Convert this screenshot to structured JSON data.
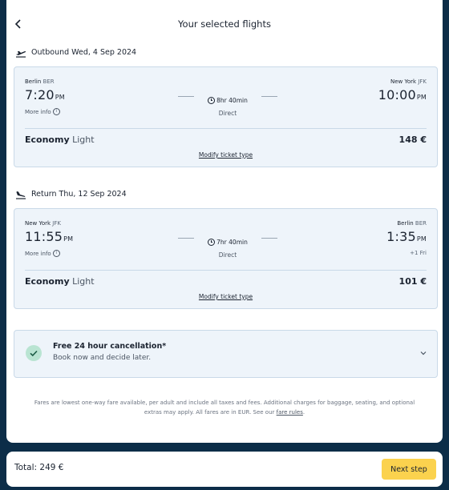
{
  "header": {
    "title": "Your selected flights"
  },
  "outbound": {
    "label": "Outbound Wed, 4 Sep 2024",
    "origin_city": "Berlin",
    "origin_code": "BER",
    "dest_city": "New York",
    "dest_code": "JFK",
    "dep_time": "7:20",
    "dep_ampm": "PM",
    "arr_time": "10:00",
    "arr_ampm": "PM",
    "duration": "8hr 40min",
    "stops": "Direct",
    "more_info": "More info",
    "fare_class": "Economy",
    "fare_type": "Light",
    "price": "148 €",
    "modify_label": "Modify ticket type"
  },
  "return": {
    "label": "Return Thu, 12 Sep 2024",
    "origin_city": "New York",
    "origin_code": "JFK",
    "dest_city": "Berlin",
    "dest_code": "BER",
    "dep_time": "11:55",
    "dep_ampm": "PM",
    "arr_time": "1:35",
    "arr_ampm": "PM",
    "day_offset": "+1 Fri",
    "duration": "7hr 40min",
    "stops": "Direct",
    "more_info": "More info",
    "fare_class": "Economy",
    "fare_type": "Light",
    "price": "101 €",
    "modify_label": "Modify ticket type"
  },
  "cancellation": {
    "title": "Free 24 hour cancellation*",
    "subtitle": "Book now and decide later."
  },
  "disclaimer": {
    "text": "Fares are lowest one-way fare available, per adult and include all taxes and fees. Additional charges for baggage, seating, and optional extras may apply. All fares are in EUR. See our",
    "link": "fare rules",
    "end": "."
  },
  "footer": {
    "total": "Total: 249 €",
    "next_label": "Next step"
  },
  "colors": {
    "accent_button": "#fbd24e",
    "box_bg": "#eef4fa",
    "check_bg": "#b9e4d2",
    "page_bg": "#0c2d48"
  },
  "icons": [
    "back-arrow-icon",
    "plane-takeoff-icon",
    "plane-landing-icon",
    "info-icon",
    "clock-icon",
    "check-icon",
    "chevron-down-icon"
  ]
}
